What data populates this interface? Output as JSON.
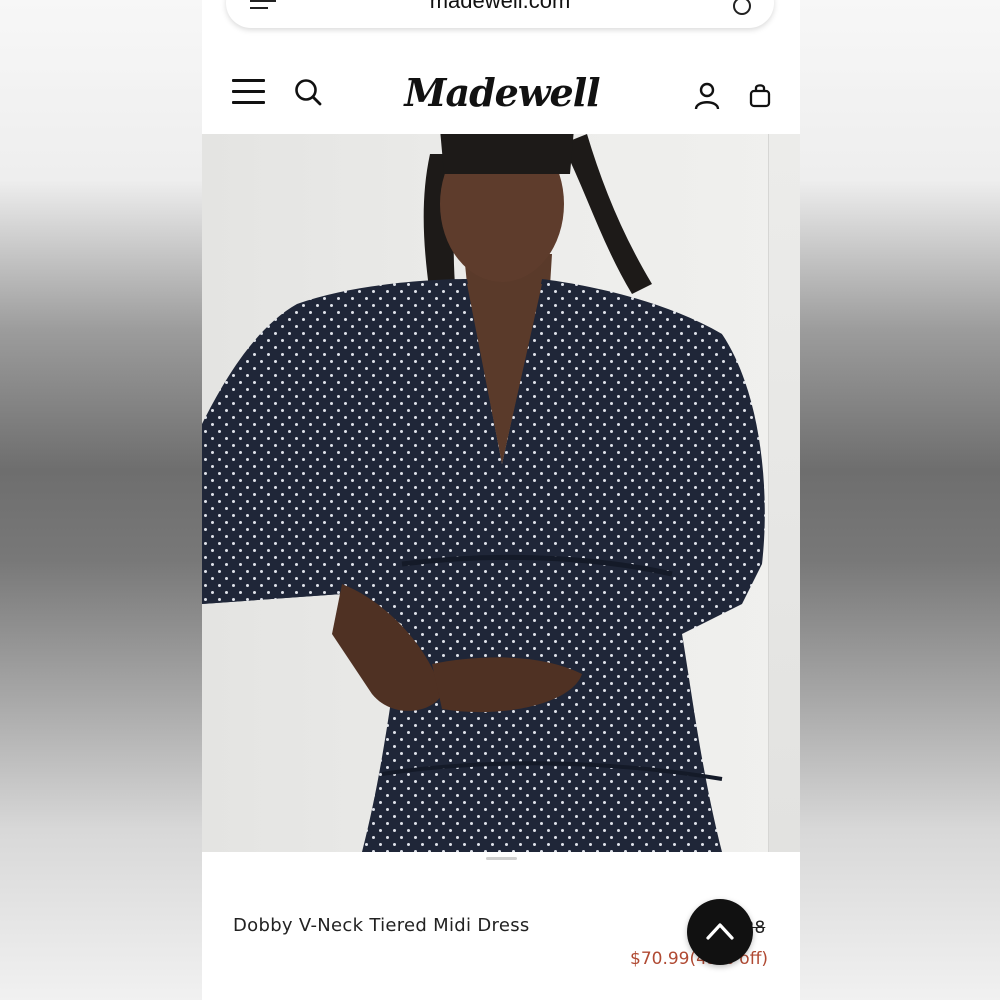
{
  "browser": {
    "url": "madewell.com"
  },
  "header": {
    "brand": "Madewell",
    "icons": [
      "menu-icon",
      "search-icon",
      "account-icon",
      "shopping-bag-icon"
    ]
  },
  "hero": {
    "image_alt": "Model wearing a navy dotted long-sleeve V-neck dress"
  },
  "product": {
    "name": "Dobby V-Neck Tiered Midi Dress",
    "original_price": "$128",
    "sale_price": "$70.99",
    "discount": "(45% off)"
  },
  "colors": {
    "sale": "#b04a33",
    "text": "#222222",
    "dress": "#1f2638",
    "button": "#111111"
  },
  "back_to_top": {
    "icon": "chevron-up-icon"
  }
}
